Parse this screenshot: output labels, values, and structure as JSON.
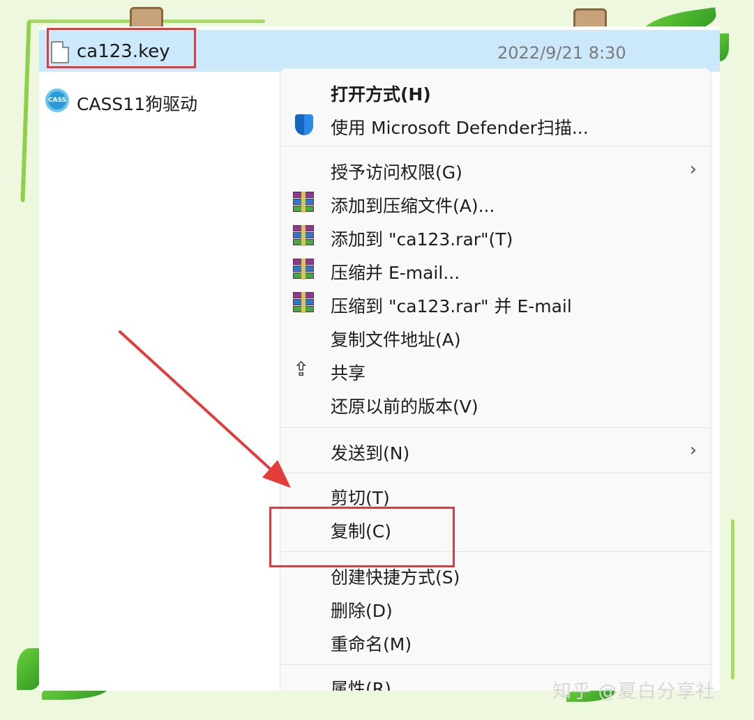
{
  "explorer": {
    "selected_file": {
      "name": "ca123.key",
      "date": "2022/9/21 8:30"
    },
    "other_file": {
      "name": "CASS11狗驱动",
      "icon": "cass-app-icon"
    }
  },
  "menu": {
    "open_with": "打开方式(H)",
    "defender": "使用 Microsoft Defender扫描...",
    "grant_access": "授予访问权限(G)",
    "add_archive": "添加到压缩文件(A)...",
    "add_to_rar": "添加到 \"ca123.rar\"(T)",
    "compress_email": "压缩并 E-mail...",
    "compress_rar_email": "压缩到 \"ca123.rar\" 并 E-mail",
    "copy_path": "复制文件地址(A)",
    "share": "共享",
    "restore": "还原以前的版本(V)",
    "send_to": "发送到(N)",
    "cut": "剪切(T)",
    "copy": "复制(C)",
    "create_shortcut": "创建快捷方式(S)",
    "delete": "删除(D)",
    "rename": "重命名(M)",
    "properties": "属性(R)",
    "chevron": "›"
  },
  "icons": {
    "defender": "defender-shield-icon",
    "rar": "winrar-icon",
    "share": "share-icon",
    "file": "file-icon"
  },
  "annotation": {
    "highlight_color": "#e03b3b"
  },
  "watermark": "知乎 @夏白分享社"
}
